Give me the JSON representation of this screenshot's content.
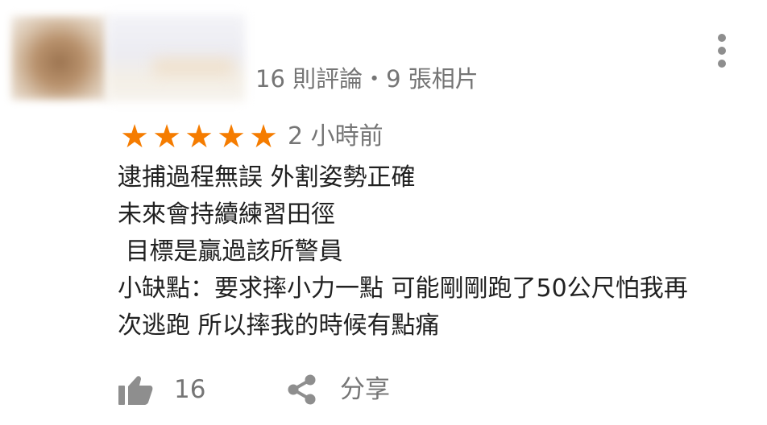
{
  "reviewer": {
    "meta": "16 則評論・9 張相片"
  },
  "rating": {
    "stars": 5,
    "max": 5,
    "star_glyph": "★",
    "color": "#f57c00"
  },
  "review": {
    "time": "2 小時前",
    "lines": [
      "逮捕過程無誤 外割姿勢正確",
      "未來會持續練習田徑",
      " 目標是贏過該所警員",
      "小缺點：要求摔小力一點 可能剛剛跑了50公尺怕我再",
      "次逃跑 所以摔我的時候有點痛"
    ]
  },
  "actions": {
    "like_icon": "thumbs-up-icon",
    "like_count": "16",
    "share_icon": "share-icon",
    "share_label": "分享"
  },
  "menu": {
    "icon": "more-vert-icon"
  },
  "colors": {
    "secondary_text": "#757575",
    "body_text": "#212121",
    "icon_gray": "#8e8e8e"
  }
}
